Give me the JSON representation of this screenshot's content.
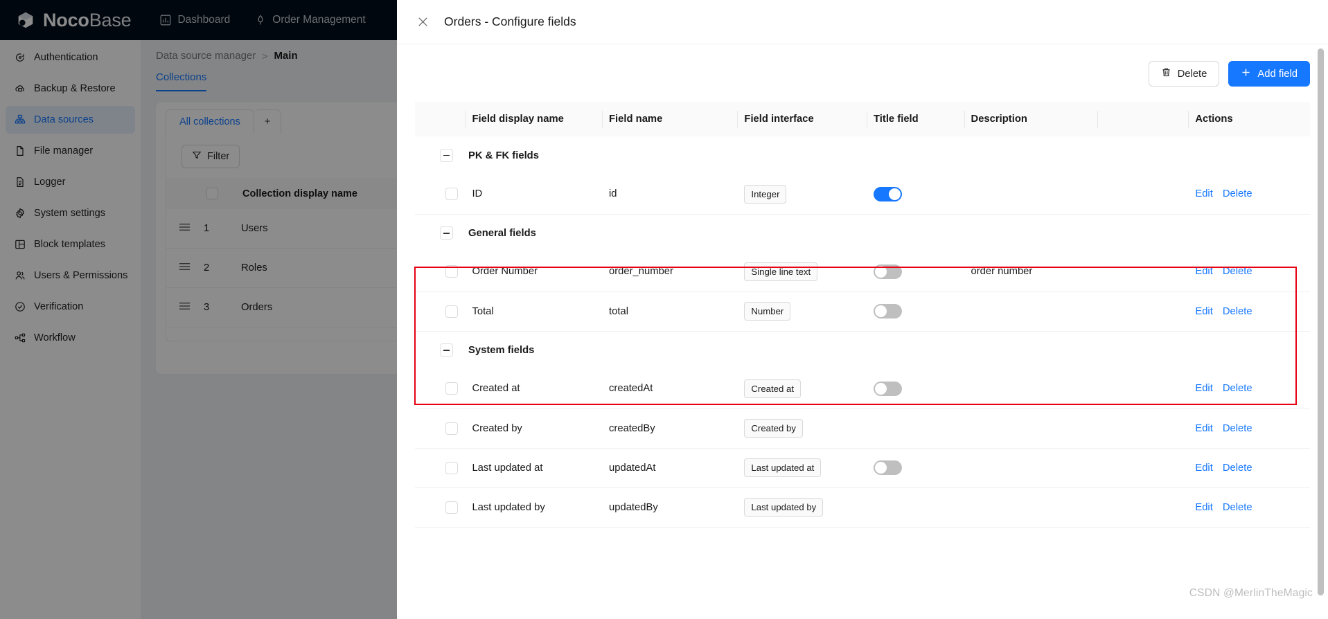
{
  "topbar": {
    "brand_bold": "Noco",
    "brand_thin": "Base",
    "nav": [
      {
        "label": "Dashboard",
        "icon": "chart-bar-icon"
      },
      {
        "label": "Order Management",
        "icon": "rocket-icon"
      }
    ]
  },
  "sidebar": {
    "items": [
      {
        "label": "Authentication",
        "icon": "login-icon",
        "active": false
      },
      {
        "label": "Backup & Restore",
        "icon": "cloud-sync-icon",
        "active": false
      },
      {
        "label": "Data sources",
        "icon": "database-tree-icon",
        "active": true
      },
      {
        "label": "File manager",
        "icon": "file-icon",
        "active": false
      },
      {
        "label": "Logger",
        "icon": "document-lines-icon",
        "active": false
      },
      {
        "label": "System settings",
        "icon": "gear-icon",
        "active": false
      },
      {
        "label": "Block templates",
        "icon": "layout-icon",
        "active": false
      },
      {
        "label": "Users & Permissions",
        "icon": "users-icon",
        "active": false
      },
      {
        "label": "Verification",
        "icon": "check-circle-icon",
        "active": false
      },
      {
        "label": "Workflow",
        "icon": "workflow-nodes-icon",
        "active": false
      }
    ]
  },
  "background_page": {
    "breadcrumb": {
      "root": "Data source manager",
      "separator": ">",
      "current": "Main"
    },
    "page_tab": "Collections",
    "collection_tabs": {
      "all": "All collections",
      "add": "+"
    },
    "filter_button": "Filter",
    "table_header": "Collection display name",
    "rows": [
      {
        "index": "1",
        "name": "Users"
      },
      {
        "index": "2",
        "name": "Roles"
      },
      {
        "index": "3",
        "name": "Orders"
      }
    ]
  },
  "drawer": {
    "title": "Orders - Configure fields",
    "close_icon": "close-icon",
    "toolbar": {
      "delete_label": "Delete",
      "delete_icon": "trash-icon",
      "add_label": "Add field",
      "add_icon": "plus-icon"
    },
    "columns": [
      "Field display name",
      "Field name",
      "Field interface",
      "Title field",
      "Description",
      "Actions"
    ],
    "actions": {
      "edit": "Edit",
      "delete": "Delete"
    },
    "groups": [
      {
        "label": "PK & FK fields",
        "highlighted": false,
        "rows": [
          {
            "display_name": "ID",
            "field_name": "id",
            "interface": "Integer",
            "title_field": true,
            "has_toggle": true,
            "description": ""
          }
        ]
      },
      {
        "label": "General fields",
        "highlighted": true,
        "rows": [
          {
            "display_name": "Order Number",
            "field_name": "order_number",
            "interface": "Single line text",
            "title_field": false,
            "has_toggle": true,
            "description": "order number"
          },
          {
            "display_name": "Total",
            "field_name": "total",
            "interface": "Number",
            "title_field": false,
            "has_toggle": true,
            "description": ""
          }
        ]
      },
      {
        "label": "System fields",
        "highlighted": false,
        "rows": [
          {
            "display_name": "Created at",
            "field_name": "createdAt",
            "interface": "Created at",
            "title_field": false,
            "has_toggle": true,
            "description": ""
          },
          {
            "display_name": "Created by",
            "field_name": "createdBy",
            "interface": "Created by",
            "title_field": false,
            "has_toggle": false,
            "description": ""
          },
          {
            "display_name": "Last updated at",
            "field_name": "updatedAt",
            "interface": "Last updated at",
            "title_field": false,
            "has_toggle": true,
            "description": ""
          },
          {
            "display_name": "Last updated by",
            "field_name": "updatedBy",
            "interface": "Last updated by",
            "title_field": false,
            "has_toggle": false,
            "description": ""
          }
        ]
      }
    ]
  },
  "watermark": "CSDN @MerlinTheMagic",
  "colors": {
    "primary": "#1677ff",
    "topbar_bg": "#030d1c",
    "highlight_border": "#e60012",
    "toggle_off": "#bfbfbf"
  }
}
